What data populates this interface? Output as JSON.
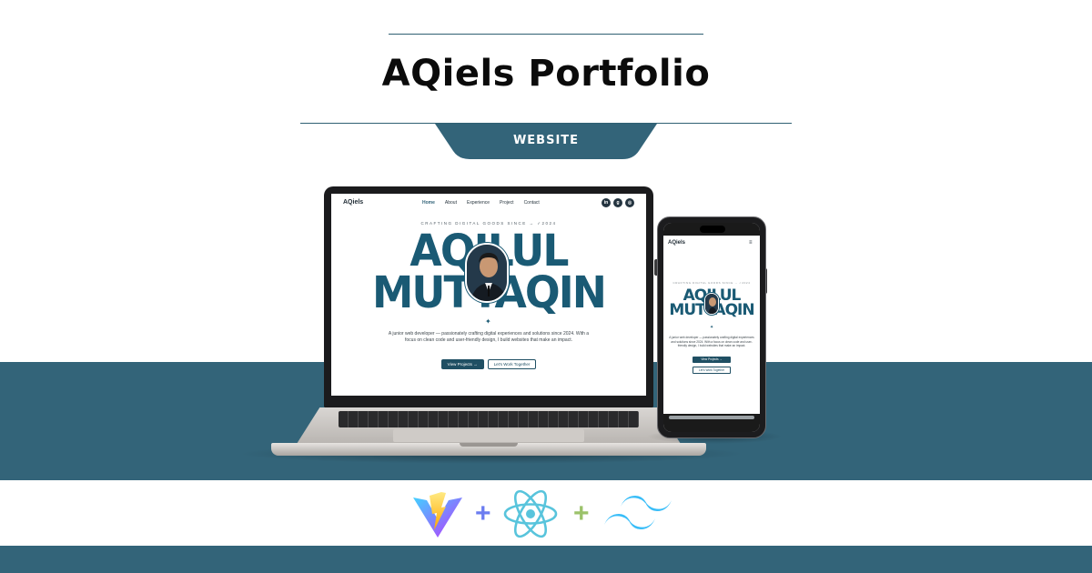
{
  "header": {
    "title": "AQiels Portfolio",
    "badge": "WEBSITE"
  },
  "laptop_site": {
    "logo": "AQiels",
    "nav": [
      "Home",
      "About",
      "Experience",
      "Project",
      "Contact"
    ],
    "social": [
      {
        "icon": "linkedin-icon",
        "glyph": "in"
      },
      {
        "icon": "github-icon",
        "glyph": "g"
      },
      {
        "icon": "instagram-icon",
        "glyph": "◎"
      }
    ],
    "tagline": "CRAFTING DIGITAL GOODS SINCE → ✓2024",
    "name_line1": "AQILUL",
    "name_line2": "MUTTAQIN",
    "description": "A junior web developer — passionately crafting digital experiences and solutions since 2024. With a focus on clean code and user-friendly design, I build websites that make an impact.",
    "primary_button": "View Projects",
    "secondary_button": "Let's Work Together"
  },
  "phone_site": {
    "logo": "AQiels",
    "tagline": "CRAFTING DIGITAL GOODS SINCE → ✓2024",
    "name_line1": "AQILUL",
    "name_line2": "MUTTAQIN",
    "description": "A junior web developer — passionately crafting digital experiences and solutions since 2024. With a focus on clean code and user-friendly design, I build websites that make an impact.",
    "primary_button": "View Projects",
    "secondary_button": "Let's Work Together"
  },
  "tech_stack": [
    "vite-logo",
    "react-logo",
    "tailwind-logo"
  ],
  "colors": {
    "brand": "#336479",
    "accent_text": "#1a5a74",
    "vite_purple": "#7c4dff",
    "vite_yellow": "#ffd23b",
    "react_blue": "#58c4dc",
    "tailwind_blue": "#38bdf8"
  }
}
